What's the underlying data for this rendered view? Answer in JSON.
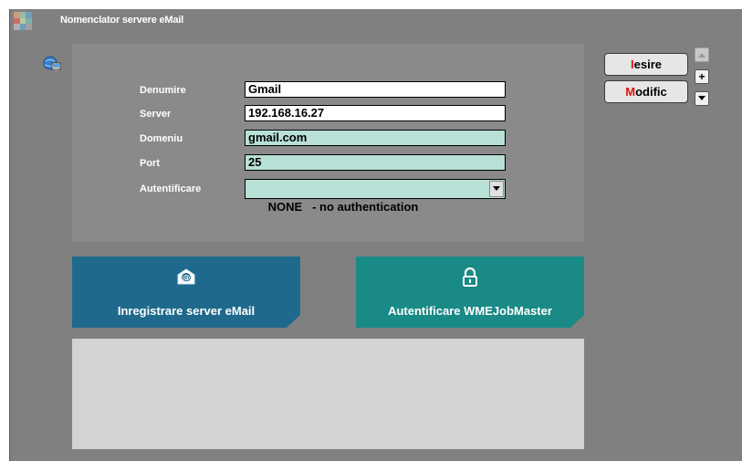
{
  "window": {
    "title": "Nomenclator servere eMail"
  },
  "form": {
    "denumire_label": "Denumire",
    "denumire_value": "Gmail",
    "server_label": "Server",
    "server_value": "192.168.16.27",
    "domeniu_label": "Domeniu",
    "domeniu_value": "gmail.com",
    "port_label": "Port",
    "port_value": "25",
    "autentificare_label": "Autentificare",
    "autentificare_value": "NONE   - no authentication"
  },
  "tiles": {
    "email_label": "Inregistrare server eMail",
    "auth_label": "Autentificare WMEJobMaster"
  },
  "buttons": {
    "iesire_hotkey": "I",
    "iesire_rest": "esire",
    "modific_hotkey": "M",
    "modific_rest": "odific",
    "plus_label": "+"
  },
  "icons": {
    "app": "app-grid-icon",
    "globe": "globe-computer-icon",
    "email": "email-at-icon",
    "lock": "padlock-icon",
    "dropdown": "chevron-down-icon",
    "scroll_up": "arrow-up-icon",
    "scroll_down": "arrow-down-icon"
  },
  "colors": {
    "window_bg": "#808080",
    "panel_bg": "#8a8a8a",
    "field_teal": "#b8e0d6",
    "tile_email": "#1f6a8c",
    "tile_auth": "#1a8a86",
    "hotkey": "#e01010"
  }
}
